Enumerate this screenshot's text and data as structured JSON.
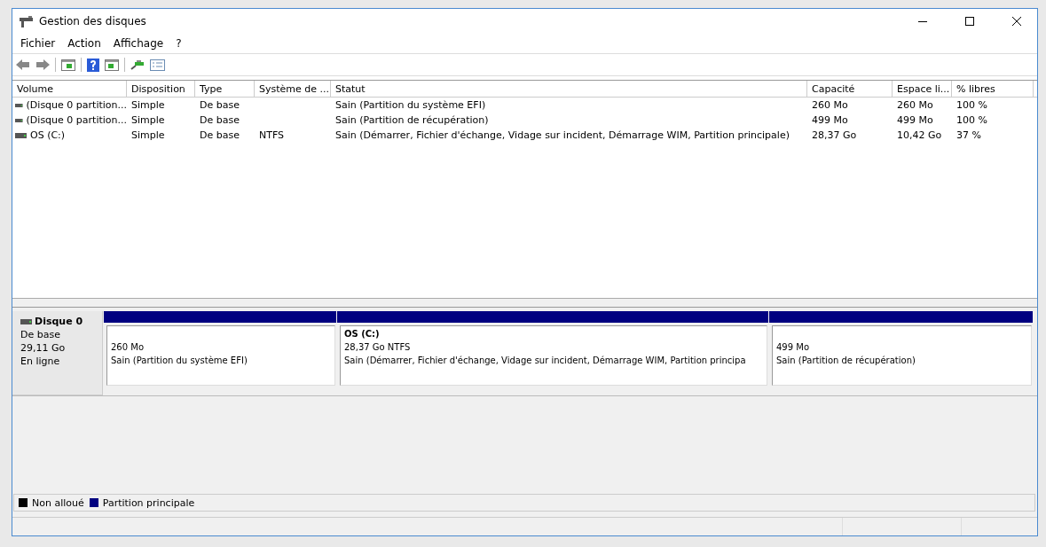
{
  "window": {
    "title": "Gestion des disques"
  },
  "menu": [
    "Fichier",
    "Action",
    "Affichage",
    "?"
  ],
  "table": {
    "columns": [
      "Volume",
      "Disposition",
      "Type",
      "Système de ...",
      "Statut",
      "Capacité",
      "Espace li...",
      "% libres"
    ],
    "rows": [
      [
        "(Disque 0 partition...",
        "Simple",
        "De base",
        "",
        "Sain (Partition du système EFI)",
        "260 Mo",
        "260 Mo",
        "100 %"
      ],
      [
        "(Disque 0 partition...",
        "Simple",
        "De base",
        "",
        "Sain (Partition de récupération)",
        "499 Mo",
        "499 Mo",
        "100 %"
      ],
      [
        "OS (C:)",
        "Simple",
        "De base",
        "NTFS",
        "Sain (Démarrer, Fichier d'échange, Vidage sur incident, Démarrage WIM, Partition principale)",
        "28,37 Go",
        "10,42 Go",
        "37 %"
      ]
    ]
  },
  "disk": {
    "name": "Disque 0",
    "type": "De base",
    "size": "29,11 Go",
    "state": "En ligne",
    "partitions": [
      {
        "size": "260 Mo",
        "status": "Sain (Partition du système EFI)"
      },
      {
        "name": "OS  (C:)",
        "size": "28,37 Go NTFS",
        "status": "Sain (Démarrer, Fichier d'échange, Vidage sur incident, Démarrage WIM, Partition principa"
      },
      {
        "size": "499 Mo",
        "status": "Sain (Partition de récupération)"
      }
    ]
  },
  "legend": [
    {
      "label": "Non alloué",
      "color": "#000000"
    },
    {
      "label": "Partition principale",
      "color": "#000080"
    }
  ]
}
